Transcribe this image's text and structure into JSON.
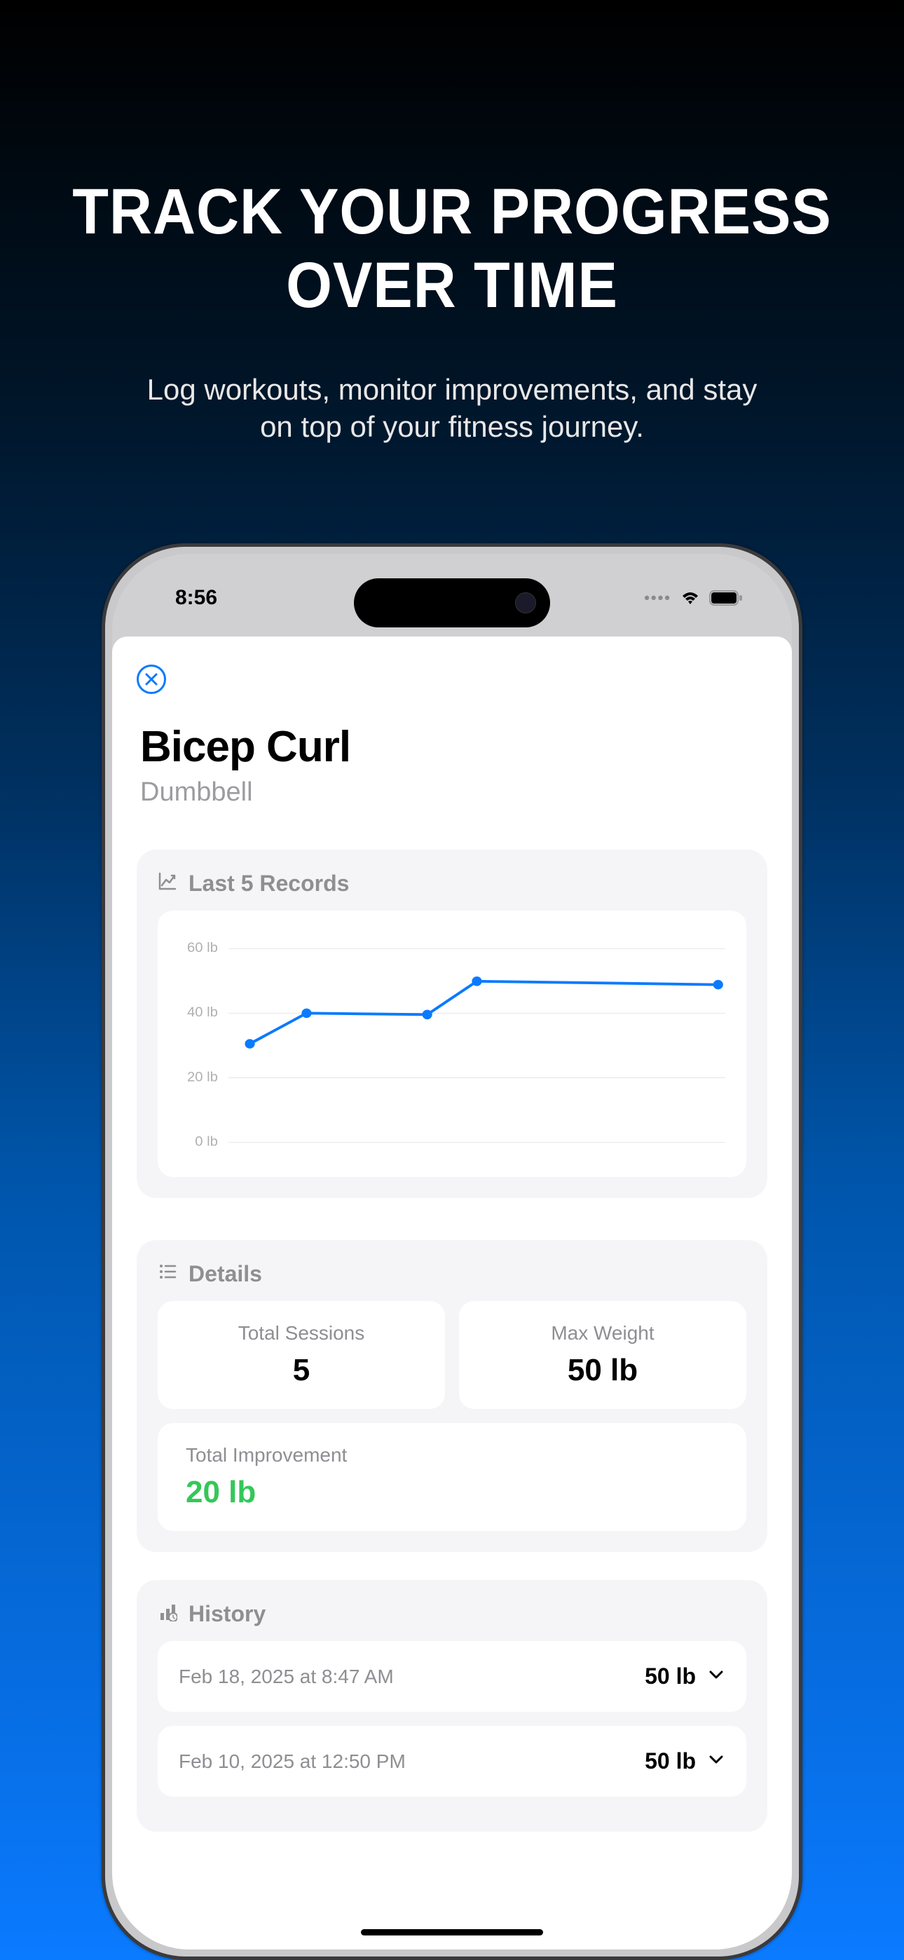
{
  "marketing": {
    "headline": "TRACK YOUR PROGRESS OVER TIME",
    "subheadline": "Log workouts, monitor improvements, and stay on top of your fitness journey."
  },
  "status": {
    "time": "8:56"
  },
  "exercise": {
    "name": "Bicep Curl",
    "equipment": "Dumbbell"
  },
  "records_section": {
    "title": "Last 5 Records"
  },
  "chart_data": {
    "type": "line",
    "title": "Last 5 Records",
    "ylabel": "lb",
    "ylim": [
      0,
      60
    ],
    "y_ticks": [
      "60 lb",
      "40 lb",
      "20 lb",
      "0 lb"
    ],
    "x": [
      1,
      2,
      3,
      4,
      5
    ],
    "values": [
      30,
      40,
      40,
      50,
      50
    ]
  },
  "details": {
    "title": "Details",
    "total_sessions_label": "Total Sessions",
    "total_sessions_value": "5",
    "max_weight_label": "Max Weight",
    "max_weight_value": "50 lb",
    "total_improvement_label": "Total Improvement",
    "total_improvement_value": "20 lb"
  },
  "history": {
    "title": "History",
    "items": [
      {
        "date": "Feb 18, 2025 at 8:47 AM",
        "weight": "50 lb"
      },
      {
        "date": "Feb 10, 2025 at 12:50 PM",
        "weight": "50 lb"
      }
    ]
  }
}
